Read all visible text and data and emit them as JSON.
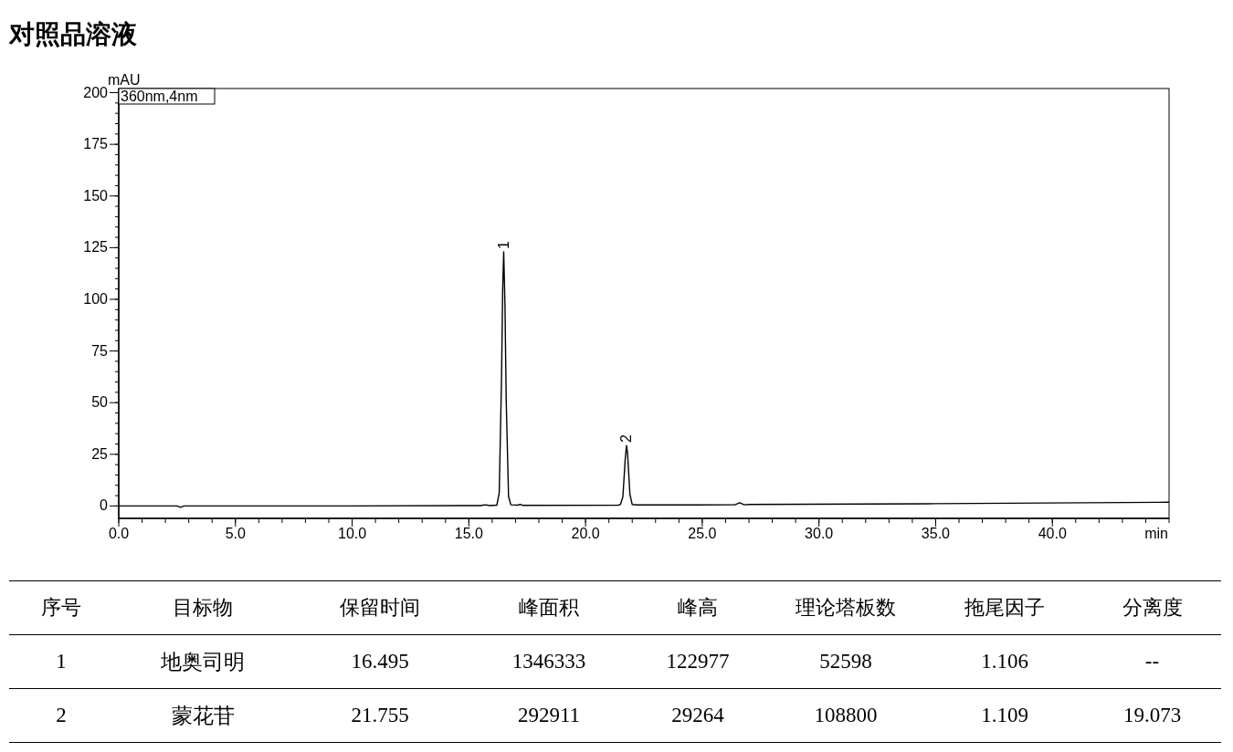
{
  "title": "对照品溶液",
  "chromatogram": {
    "chart_data": {
      "type": "line",
      "xlabel": "min",
      "ylabel": "mAU",
      "xlim": [
        0,
        45
      ],
      "ylim": [
        -6,
        202
      ],
      "xticks": [
        {
          "value": 0,
          "label": "0.0"
        },
        {
          "value": 5,
          "label": "5.0"
        },
        {
          "value": 10,
          "label": "10.0"
        },
        {
          "value": 15,
          "label": "15.0"
        },
        {
          "value": 20,
          "label": "20.0"
        },
        {
          "value": 25,
          "label": "25.0"
        },
        {
          "value": 30,
          "label": "30.0"
        },
        {
          "value": 35,
          "label": "35.0"
        },
        {
          "value": 40,
          "label": "40.0"
        }
      ],
      "yticks": [
        0,
        25,
        50,
        75,
        100,
        125,
        150,
        175,
        200
      ],
      "x": [
        0,
        2.5,
        2.65,
        2.8,
        10,
        15.5,
        15.7,
        15.9,
        16.2,
        16.3,
        16.4,
        16.45,
        16.495,
        16.55,
        16.6,
        16.7,
        16.8,
        17.1,
        17.2,
        17.3,
        21.4,
        21.5,
        21.6,
        21.7,
        21.755,
        21.8,
        21.9,
        22.0,
        22.2,
        26.4,
        26.6,
        26.8,
        27,
        35,
        45
      ],
      "series": [
        {
          "name": "360nm,4nm",
          "color": "#000000",
          "values": [
            0,
            0,
            -0.6,
            0,
            0,
            0.2,
            0.6,
            0.2,
            0.4,
            6.3,
            61,
            105,
            123,
            97,
            52,
            4.6,
            0.6,
            0.4,
            0.8,
            0.3,
            0.4,
            0.8,
            4.5,
            23,
            29.3,
            25.6,
            5.6,
            0.7,
            0.5,
            0.6,
            1.6,
            0.6,
            0.7,
            1.1,
            1.8
          ]
        }
      ],
      "annotations": [
        {
          "x": 16.495,
          "y": 123,
          "text": "1"
        },
        {
          "x": 21.755,
          "y": 29.3,
          "text": "2"
        }
      ]
    }
  },
  "table": {
    "columns": [
      "序号",
      "目标物",
      "保留时间",
      "峰面积",
      "峰高",
      "理论塔板数",
      "拖尾因子",
      "分离度"
    ],
    "rows": [
      [
        "1",
        "地奥司明",
        "16.495",
        "1346333",
        "122977",
        "52598",
        "1.106",
        "--"
      ],
      [
        "2",
        "蒙花苷",
        "21.755",
        "292911",
        "29264",
        "108800",
        "1.109",
        "19.073"
      ]
    ]
  }
}
